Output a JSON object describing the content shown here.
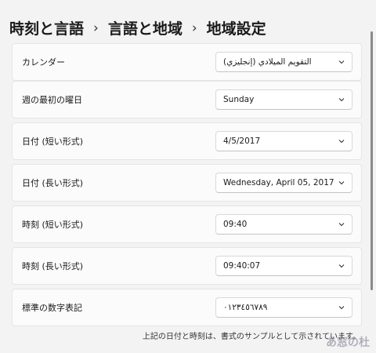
{
  "breadcrumb": {
    "item1": "時刻と言語",
    "item2": "言語と地域",
    "item3": "地域設定",
    "separator": "›"
  },
  "settings": [
    {
      "label": "カレンダー",
      "value": "التقويم الميلادي (إنجليزي)"
    },
    {
      "label": "週の最初の曜日",
      "value": "Sunday"
    },
    {
      "label": "日付 (短い形式)",
      "value": "4/5/2017"
    },
    {
      "label": "日付 (長い形式)",
      "value": "Wednesday, April 05, 2017"
    },
    {
      "label": "時刻 (短い形式)",
      "value": "09:40"
    },
    {
      "label": "時刻 (長い形式)",
      "value": "09:40:07"
    },
    {
      "label": "標準の数字表記",
      "value": "٠١٢٣٤٥٦٧٨٩"
    }
  ],
  "footer_note": "上記の日付と時刻は、書式のサンプルとして示されています。",
  "watermark": "あ窓の杜",
  "icons": {
    "dropdown": "chevron-down-icon"
  }
}
